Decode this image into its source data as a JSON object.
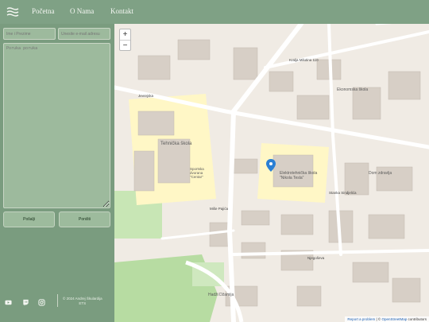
{
  "nav": {
    "home": "Početna",
    "about": "O Nama",
    "contact": "Kontakt"
  },
  "form": {
    "name_placeholder": "Ime i Prezime",
    "email_placeholder": "Unesite e-mail adresu",
    "message_placeholder": "Poruka poruka",
    "send_label": "Pošalji",
    "reset_label": "Poništi"
  },
  "footer": {
    "line1": "© 2024 Andrej Škulardija",
    "line2": "ETS"
  },
  "social": [
    "youtube-icon",
    "twitch-icon",
    "instagram-icon"
  ],
  "map": {
    "zoom_in": "+",
    "zoom_out": "−",
    "attribution_link1": "Report a problem",
    "attribution_sep": " | © ",
    "attribution_link2": "OpenStreetMap",
    "attribution_tail": " contributors",
    "labels": {
      "tehnicka": "Tehnička škola",
      "elektro": "Elektrotehnička škola \"Nikola Tesla\"",
      "sportska": "Sportska dvorana \"Centar\"",
      "jevrejska": "Jevrejska",
      "kralja": "Kralja Milutina 110",
      "mise": "Miše Pajića",
      "njegoseva": "Njegoševa",
      "sindjelic": "Stanka Sindjelića",
      "skola": "Ekonomska škola",
      "zdravlje": "Dom zdravlja",
      "dzamija": "Hadži Džamija"
    }
  }
}
